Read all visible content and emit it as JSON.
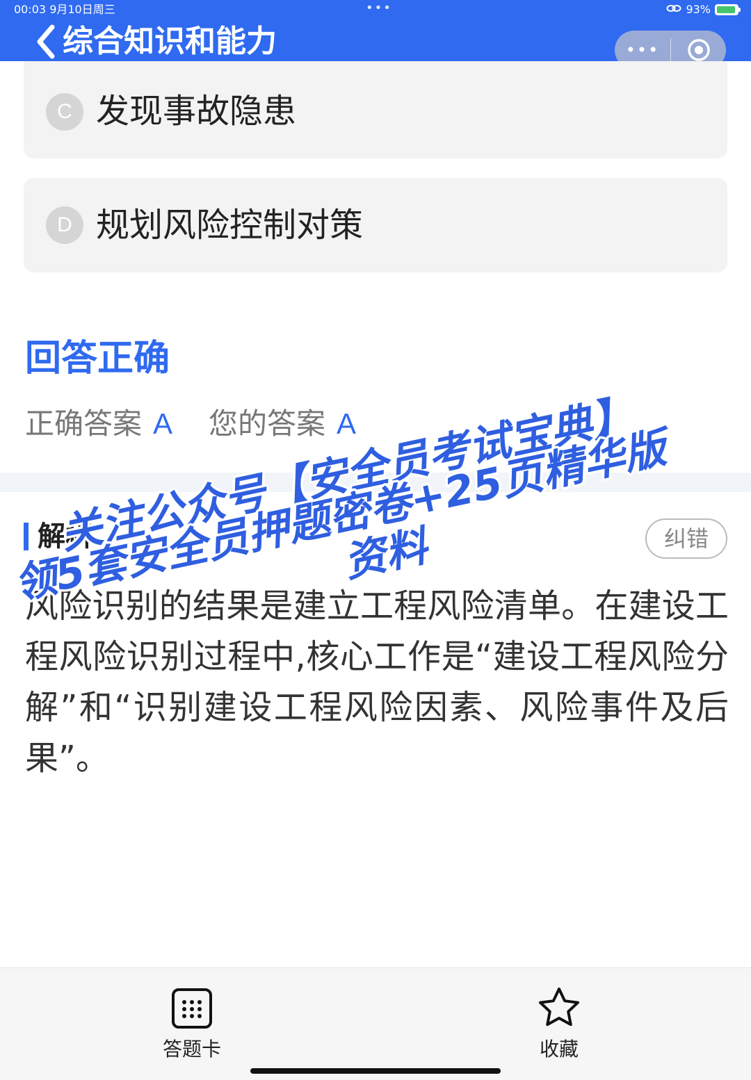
{
  "status_bar": {
    "time": "00:03  9月10日周三",
    "dots": "•••",
    "battery": "93%"
  },
  "header": {
    "title": "综合知识和能力",
    "capsule_more": "•••"
  },
  "options": [
    {
      "letter": "C",
      "text": "发现事故隐患"
    },
    {
      "letter": "D",
      "text": "规划风险控制对策"
    }
  ],
  "result": {
    "title": "回答正确",
    "correct_label": "正确答案",
    "correct_value": "A",
    "yours_label": "您的答案",
    "yours_value": "A"
  },
  "analysis": {
    "label": "解析",
    "correct_button": "纠错",
    "text": "风险识别的结果是建立工程风险清单。在建设工程风险识别过程中,核心工作是“建设工程风险分解”和“识别建设工程风险因素、风险事件及后果”。"
  },
  "watermark": {
    "line1": "关注公众号【安全员考试宝典】",
    "line2": "领5套安全员押题密卷+25页精华版",
    "line3": "资料"
  },
  "bottom_bar": {
    "card_label": "答题卡",
    "favorite_label": "收藏"
  },
  "colors": {
    "primary": "#2f6af0",
    "option_bg": "#f3f3f3",
    "battery_green": "#45c46e"
  }
}
